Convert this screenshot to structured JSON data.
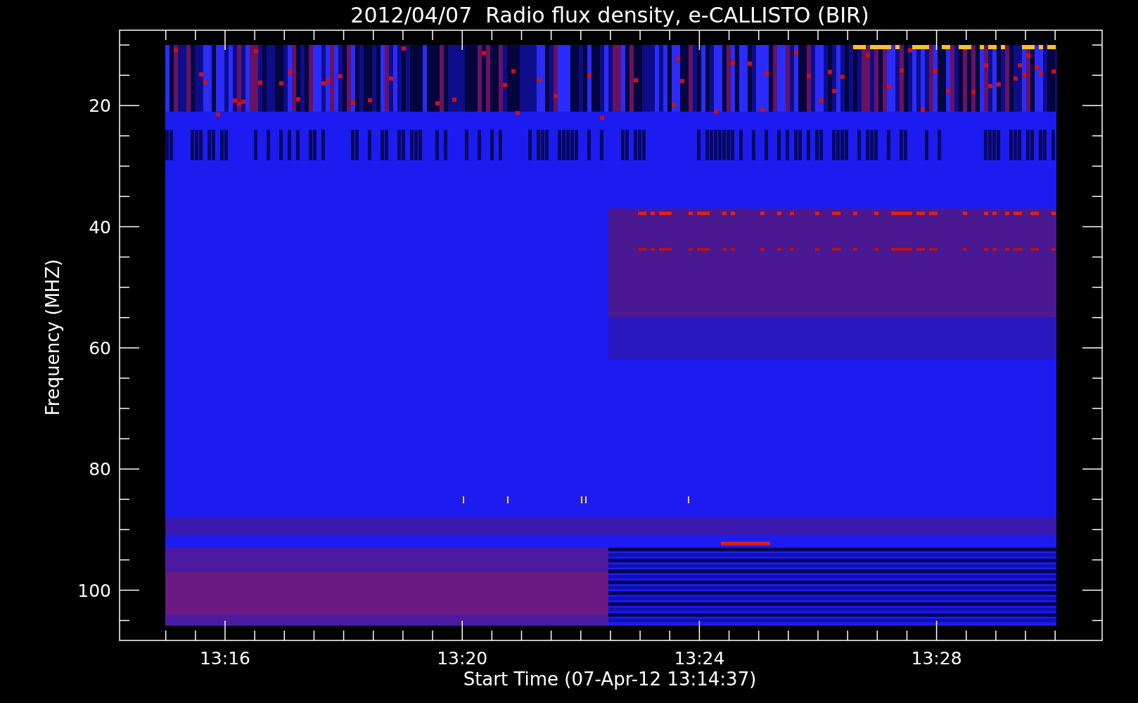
{
  "plot": {
    "title": "2012/04/07  Radio flux density, e-CALLISTO (BIR)",
    "ylabel": "Frequency (MHZ)",
    "xlabel": "Start Time (07-Apr-12 13:14:37)",
    "yticks": [
      "20",
      "40",
      "60",
      "80",
      "100"
    ],
    "xticks": [
      "13:16",
      "13:20",
      "13:24",
      "13:28"
    ]
  }
}
